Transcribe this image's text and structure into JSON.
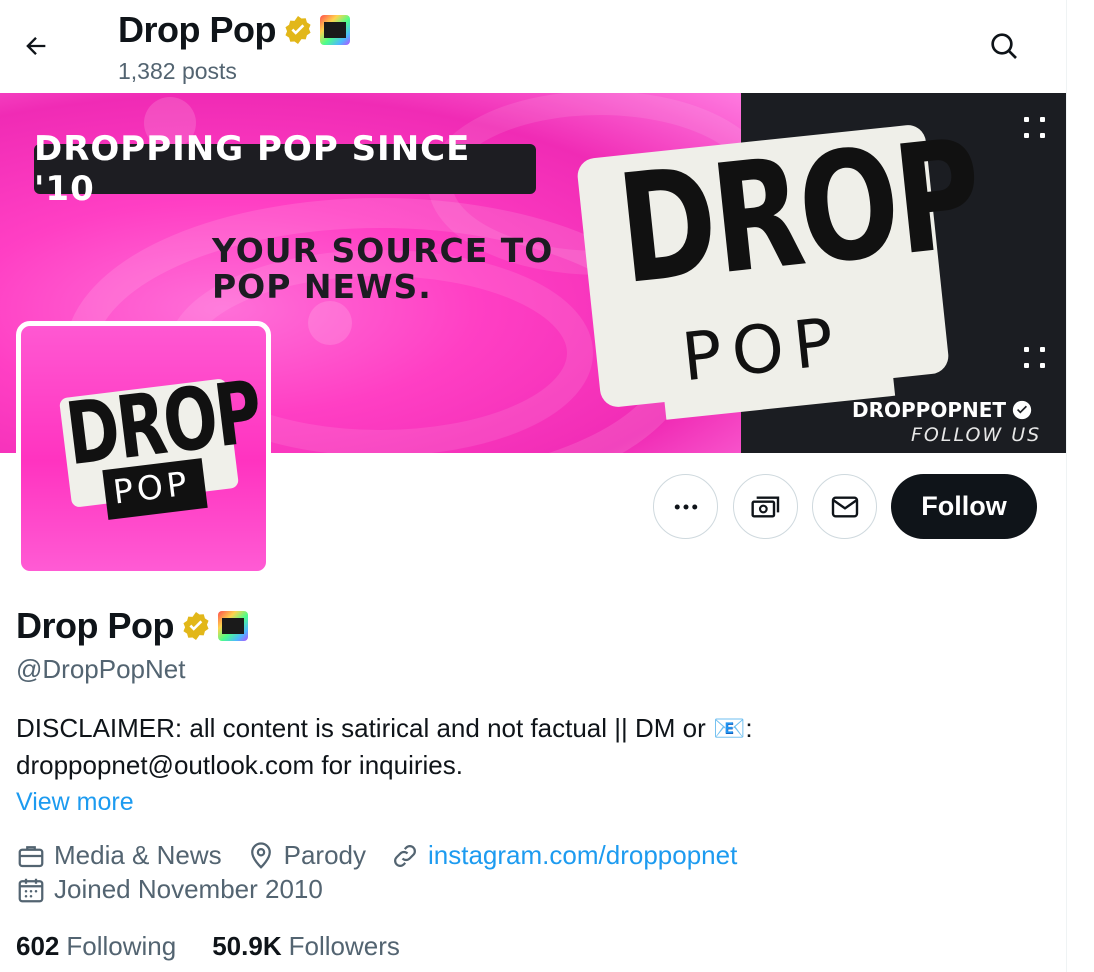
{
  "header": {
    "title": "Drop Pop",
    "posts_count": "1,382 posts"
  },
  "banner": {
    "tagline": "DROPPING POP SINCE '10",
    "source_line1": "YOUR SOURCE TO",
    "source_line2": "POP NEWS.",
    "logo_drop": "DROP",
    "logo_pop": "POP",
    "brand_handle": "DROPPOPNET",
    "follow_us": "FOLLOW US",
    "pink_color": "#ff3fc4",
    "dark_color": "#1b1d22"
  },
  "avatar": {
    "drop": "DROP",
    "pop": "POP"
  },
  "actions": {
    "follow_label": "Follow"
  },
  "profile": {
    "name": "Drop Pop",
    "handle": "@DropPopNet",
    "bio_line1": "DISCLAIMER: all content is satirical and not factual || DM or 📧:",
    "bio_line2": "droppopnet@outlook.com for inquiries.",
    "view_more": "View more",
    "category": "Media & News",
    "location": "Parody",
    "website": "instagram.com/droppopnet",
    "joined": "Joined November 2010",
    "following_count": "602",
    "following_label": "Following",
    "followers_count": "50.9K",
    "followers_label": "Followers"
  },
  "colors": {
    "accent": "#1d9bf0",
    "verified_gold": "#e2b719",
    "text_secondary": "#536471"
  },
  "icons": {
    "back": "arrow-left-icon",
    "search": "search-icon",
    "more": "more-icon",
    "subscribe": "money-icon",
    "message": "envelope-icon",
    "category": "briefcase-icon",
    "location": "location-pin-icon",
    "link": "link-icon",
    "calendar": "calendar-icon"
  }
}
